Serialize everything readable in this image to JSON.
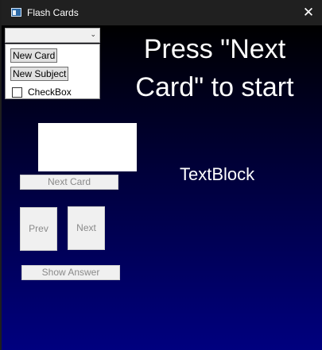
{
  "window": {
    "title": "Flash Cards",
    "close_glyph": "✕",
    "icon": "app-window-icon"
  },
  "combo": {
    "selected_value": "",
    "arrow_glyph": "⌄"
  },
  "menu": {
    "new_card_label": "New Card",
    "new_subject_label": "New Subject",
    "checkbox_label": "CheckBox",
    "checkbox_checked": false
  },
  "main": {
    "headline_line1": "Press \"Next",
    "headline_line2": "Card\" to start",
    "textblock": "TextBlock",
    "next_card_label": "Next Card",
    "prev_label": "Prev",
    "next_label": "Next",
    "show_answer_label": "Show Answer"
  },
  "colors": {
    "background_top": "#000000",
    "background_bottom": "#00007f",
    "titlebar": "#202020",
    "text": "#ffffff"
  }
}
